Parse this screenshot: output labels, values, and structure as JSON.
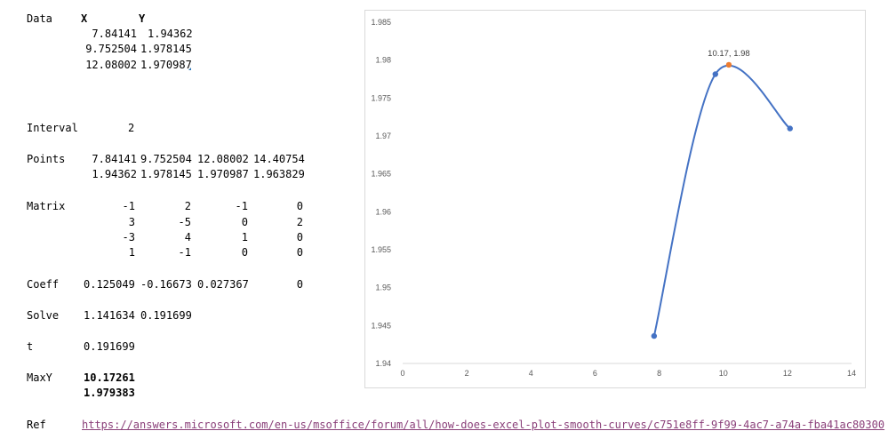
{
  "sheet": {
    "data_label": "Data",
    "x_header": "X",
    "y_header": "Y",
    "data_rows": [
      {
        "x": "7.84141",
        "y": "1.94362"
      },
      {
        "x": "9.752504",
        "y": "1.978145"
      },
      {
        "x": "12.08002",
        "y": "1.970987"
      }
    ],
    "interval_label": "Interval",
    "interval_value": "2",
    "points_label": "Points",
    "points_row1": [
      "7.84141",
      "9.752504",
      "12.08002",
      "14.40754"
    ],
    "points_row2": [
      "1.94362",
      "1.978145",
      "1.970987",
      "1.963829"
    ],
    "matrix_label": "Matrix",
    "matrix": [
      [
        "-1",
        "2",
        "-1",
        "0"
      ],
      [
        "3",
        "-5",
        "0",
        "2"
      ],
      [
        "-3",
        "4",
        "1",
        "0"
      ],
      [
        "1",
        "-1",
        "0",
        "0"
      ]
    ],
    "coeff_label": "Coeff",
    "coeff": [
      "0.125049",
      "-0.16673",
      "0.027367",
      "0"
    ],
    "solve_label": "Solve",
    "solve": [
      "1.141634",
      "0.191699"
    ],
    "t_label": "t",
    "t_value": "0.191699",
    "maxy_label": "MaxY",
    "maxy_x": "10.17261",
    "maxy_y": "1.979383",
    "ref_label": "Ref",
    "ref_url": "https://answers.microsoft.com/en-us/msoffice/forum/all/how-does-excel-plot-smooth-curves/c751e8ff-9f99-4ac7-a74a-fba41ac80300"
  },
  "colors": {
    "series_line": "#4472c4",
    "series_marker": "#4472c4",
    "max_marker": "#ed7d31",
    "link": "#8a3f79"
  },
  "chart_data": {
    "type": "scatter",
    "title": "",
    "xlabel": "",
    "ylabel": "",
    "xlim": [
      0,
      14
    ],
    "ylim": [
      1.94,
      1.985
    ],
    "x_ticks": [
      "0",
      "2",
      "4",
      "6",
      "8",
      "10",
      "12",
      "14"
    ],
    "y_ticks": [
      "1.94",
      "1.945",
      "1.95",
      "1.955",
      "1.96",
      "1.965",
      "1.97",
      "1.975",
      "1.98",
      "1.985"
    ],
    "grid": false,
    "legend": "none",
    "series": [
      {
        "smooth": true,
        "points": [
          {
            "x": 7.84141,
            "y": 1.94362
          },
          {
            "x": 9.752504,
            "y": 1.978145
          },
          {
            "x": 12.08002,
            "y": 1.970987
          }
        ]
      },
      {
        "points": [
          {
            "x": 10.17261,
            "y": 1.979383
          }
        ],
        "data_label": "10.17, 1.98"
      }
    ]
  }
}
